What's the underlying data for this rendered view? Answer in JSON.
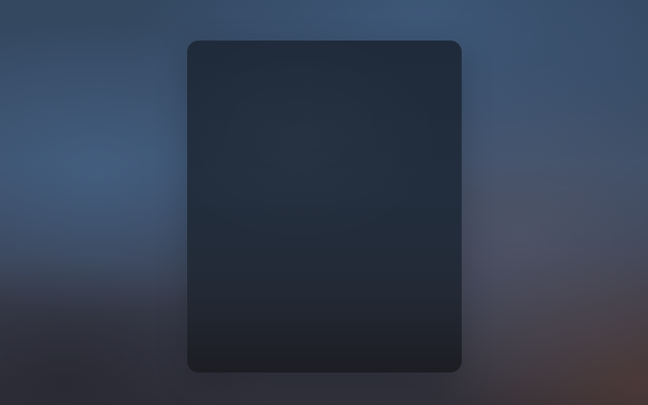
{
  "scene": {
    "background": {
      "top_left_color": "#33475f",
      "center_color": "#3c5572",
      "right_mid_color": "#4a4f60",
      "bottom_right_color": "#3c2c28"
    },
    "panel": {
      "top_color": "#1f2b3b",
      "bottom_color": "#1d1d23"
    }
  }
}
